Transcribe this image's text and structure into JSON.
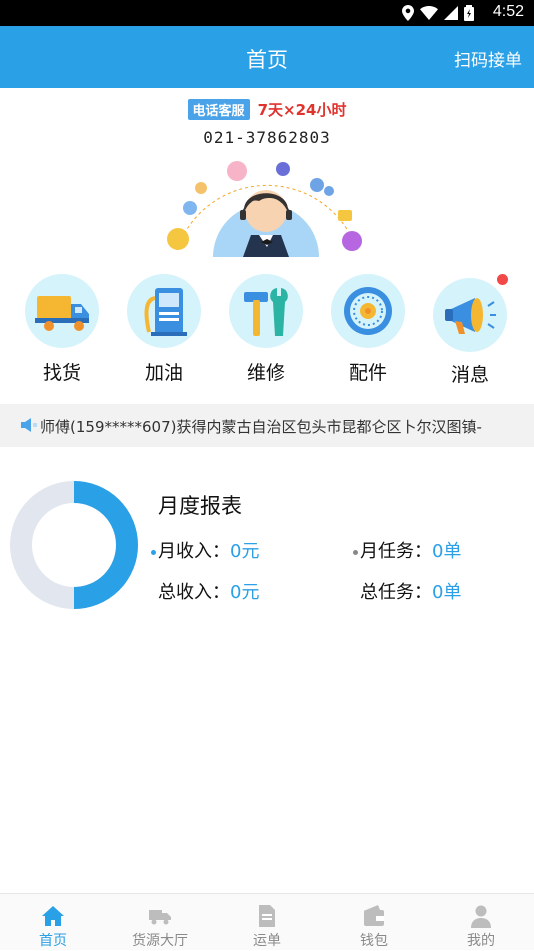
{
  "status_bar": {
    "time": "4:52"
  },
  "header": {
    "title": "首页",
    "scan_label": "扫码接单"
  },
  "hotline": {
    "badge": "电话客服",
    "hours": "7天×24小时",
    "phone": "021-37862803"
  },
  "quick_menu": [
    {
      "label": "找货",
      "icon": "truck-icon"
    },
    {
      "label": "加油",
      "icon": "fuel-pump-icon"
    },
    {
      "label": "维修",
      "icon": "repair-tools-icon"
    },
    {
      "label": "配件",
      "icon": "parts-dial-icon"
    },
    {
      "label": "消息",
      "icon": "megaphone-icon",
      "has_unread": true
    }
  ],
  "notice": {
    "text": "师傅(159*****607)获得内蒙古自治区包头市昆都仑区卜尔汉图镇-"
  },
  "report": {
    "title": "月度报表",
    "monthly_income_label": "月收入：",
    "monthly_income_value": "0元",
    "monthly_tasks_label": "月任务：",
    "monthly_tasks_value": "0单",
    "total_income_label": "总收入：",
    "total_income_value": "0元",
    "total_tasks_label": "总任务：",
    "total_tasks_value": "0单",
    "donut_fill_fraction": 0.5
  },
  "tabs": [
    {
      "label": "首页",
      "icon": "home-icon",
      "active": true
    },
    {
      "label": "货源大厅",
      "icon": "truck-icon",
      "active": false
    },
    {
      "label": "运单",
      "icon": "document-icon",
      "active": false
    },
    {
      "label": "钱包",
      "icon": "wallet-icon",
      "active": false
    },
    {
      "label": "我的",
      "icon": "person-icon",
      "active": false
    }
  ],
  "colors": {
    "accent": "#2aa0e6",
    "alert": "#f24848",
    "hours_red": "#e0332e"
  }
}
